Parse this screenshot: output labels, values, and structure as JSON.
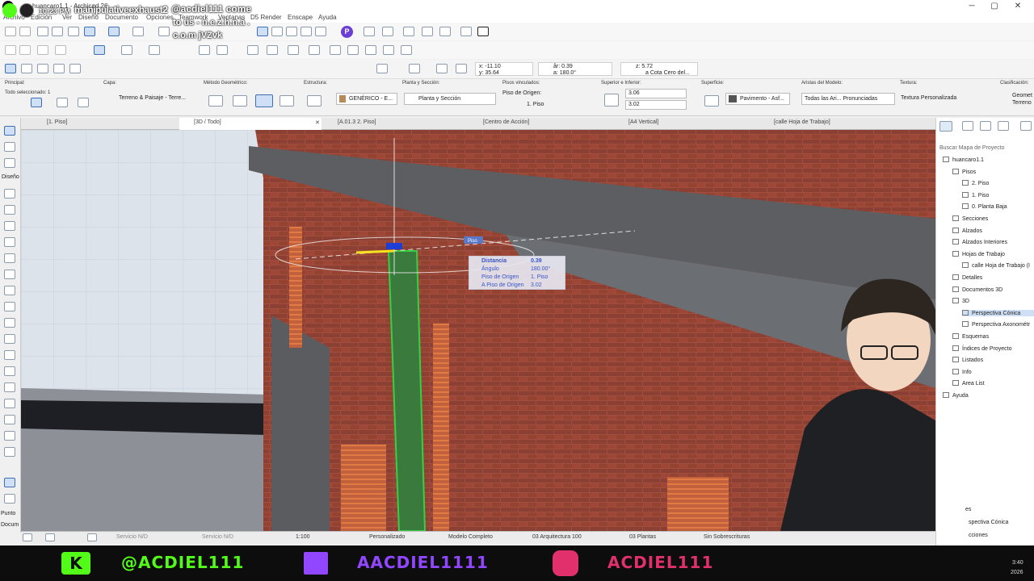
{
  "window": {
    "title": "huancaro1.1 - Archicad 26",
    "controls": [
      "─",
      "▢",
      "✕"
    ]
  },
  "menus": [
    "Archivo",
    "Edición",
    "Ver",
    "Diseño",
    "Documento",
    "Opciones",
    "Teamwork",
    "Ventanas",
    "D5 Render",
    "Enscape",
    "Ayuda"
  ],
  "overlay": {
    "time": "10:23 PM",
    "handle": "manipulativeexhaust2",
    "promo": [
      "@acdiel111 come",
      "to us - n.e.z.h.n.a .",
      "c.o.m jVZvk"
    ]
  },
  "coords": {
    "x": "x: -11.10",
    "y": "y: 35.64",
    "ar": "år: 0.39",
    "a": "a: 180.0°",
    "z": "z: 5.72",
    "zref": "a Cota Cero del..."
  },
  "infobox": {
    "principal": "Principal:",
    "selected": "Todo seleccionado: 1",
    "capa_label": "Capa:",
    "capa_value": "Terreno & Paisaje - Terre...",
    "metodo_label": "Método Geométrico:",
    "estructura_label": "Estructura:",
    "estructura_value": "GENÉRICO - E...",
    "planta_label": "Planta y Sección:",
    "planta_value": "Planta y Sección",
    "pisos_label": "Pisos vinculados:",
    "piso_origen_label": "Piso de Origen:",
    "piso_origen_value": "1. Piso",
    "sup_label": "Superior e Inferior:",
    "sup_value1": "3.06",
    "sup_value2": "3.02",
    "superficie_label": "Superficie:",
    "superficie_value": "Pavimento - Asf...",
    "aristas_label": "Aristas del Modelo:",
    "aristas_value": "Todas las Ari... Pronunciadas",
    "textura_label": "Textura:",
    "textura_value": "Textura Personalizada",
    "clasif_label": "Clasificación:",
    "clasif_value1": "Geomet",
    "clasif_value2": "Terreno"
  },
  "tabs": [
    "[1. Piso]",
    "[3D / Todo]",
    "[A.01.3 2. Piso]",
    "[Centro de Acción]",
    "[A4 Vertical]",
    "[calle Hoja de Trabajo]"
  ],
  "left_toolbar": {
    "section": "Diseño",
    "bottom1": "Punto",
    "bottom2": "Docum"
  },
  "tooltip": {
    "tag": "Piso",
    "rows": [
      {
        "label": "Distancia",
        "value": "0.39"
      },
      {
        "label": "Ángulo",
        "value": "180.00°"
      },
      {
        "label": "Piso de Origen",
        "value": "1. Piso"
      },
      {
        "label": "A Piso de Origen",
        "value": "3.02"
      }
    ]
  },
  "navigator": {
    "search": "Buscar Mapa de Proyecto",
    "items": [
      {
        "label": "huancaro1.1",
        "indent": 0
      },
      {
        "label": "Pisos",
        "indent": 1
      },
      {
        "label": "2. Piso",
        "indent": 2
      },
      {
        "label": "1. Piso",
        "indent": 2
      },
      {
        "label": "0. Planta Baja",
        "indent": 2
      },
      {
        "label": "Secciones",
        "indent": 1
      },
      {
        "label": "Alzados",
        "indent": 1
      },
      {
        "label": "Alzados Interiores",
        "indent": 1
      },
      {
        "label": "Hojas de Trabajo",
        "indent": 1
      },
      {
        "label": "calle Hoja de Trabajo (I",
        "indent": 2
      },
      {
        "label": "Detalles",
        "indent": 1
      },
      {
        "label": "Documentos 3D",
        "indent": 1
      },
      {
        "label": "3D",
        "indent": 1
      },
      {
        "label": "Perspectiva Cónica",
        "indent": 2
      },
      {
        "label": "Perspectiva Axonométr",
        "indent": 2
      },
      {
        "label": "Esquemas",
        "indent": 1
      },
      {
        "label": "Índices de Proyecto",
        "indent": 1
      },
      {
        "label": "Listados",
        "indent": 1
      },
      {
        "label": "Info",
        "indent": 1
      },
      {
        "label": "Area List",
        "indent": 1
      },
      {
        "label": "Ayuda",
        "indent": 0
      }
    ],
    "bottom": [
      "es",
      "spectiva Cónica",
      "cciones"
    ]
  },
  "statusbar": {
    "service1": "Servicio N/D",
    "service2": "Servicio N/D",
    "scale": "1:100",
    "custom": "Personalizado",
    "model": "Modelo Completo",
    "arch": "03 Arquitectura 100",
    "plantas": "03 Plantas",
    "sobres": "Sin Sobrescrituras"
  },
  "stream": {
    "kick": "@ACDIEL111",
    "twitch": "AACDIEL1111",
    "instagram": "ACDIEL111",
    "clock_time": "3:40",
    "clock_year": "2026"
  },
  "colors": {
    "brick": "#9c4a3b",
    "kick_green": "#53fc18",
    "twitch_purple": "#9146ff",
    "instagram_pink": "#e1306c",
    "selection_green": "#35d043",
    "accent_blue": "#3c6fb4"
  }
}
